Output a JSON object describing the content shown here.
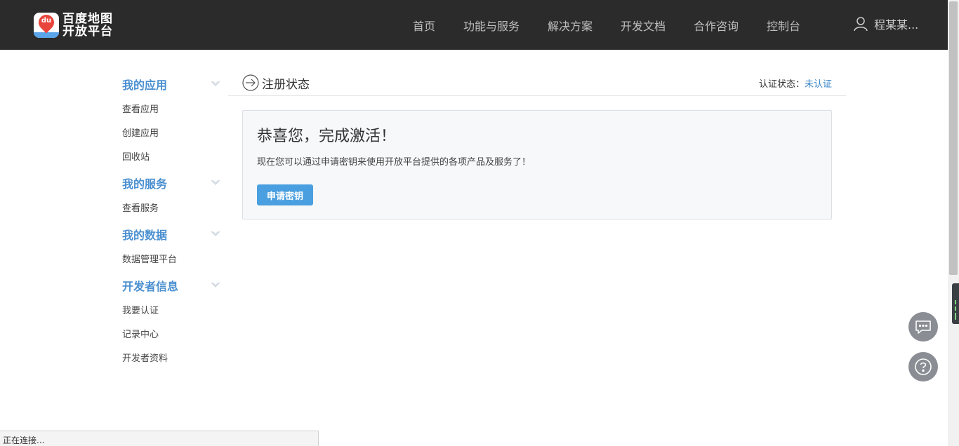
{
  "header": {
    "logo_line1": "百度地图",
    "logo_line2": "开放平台",
    "logo_badge": "du",
    "nav": [
      {
        "label": "首页"
      },
      {
        "label": "功能与服务"
      },
      {
        "label": "解决方案"
      },
      {
        "label": "开发文档"
      },
      {
        "label": "合作咨询"
      },
      {
        "label": "控制台"
      }
    ],
    "user_name": "程某某...",
    "user_icon": "user-icon"
  },
  "sidebar": {
    "sections": [
      {
        "title": "我的应用",
        "items": [
          "查看应用",
          "创建应用",
          "回收站"
        ]
      },
      {
        "title": "我的服务",
        "items": [
          "查看服务"
        ]
      },
      {
        "title": "我的数据",
        "items": [
          "数据管理平台"
        ]
      },
      {
        "title": "开发者信息",
        "items": [
          "我要认证",
          "记录中心",
          "开发者资料"
        ]
      }
    ]
  },
  "main": {
    "title": "注册状态",
    "auth_label": "认证状态：",
    "auth_status": "未认证",
    "headline": "恭喜您，完成激活！",
    "description": "现在您可以通过申请密钥来使用开放平台提供的各项产品及服务了！",
    "apply_button": "申请密钥"
  },
  "floating": {
    "chat_icon": "chat-icon",
    "help_icon": "help-icon"
  },
  "statusbar": {
    "text": "正在连接..."
  },
  "colors": {
    "topbar": "#2b2b2b",
    "accent": "#4a8fd0",
    "button": "#4a9fe0",
    "link": "#3a86c8"
  }
}
